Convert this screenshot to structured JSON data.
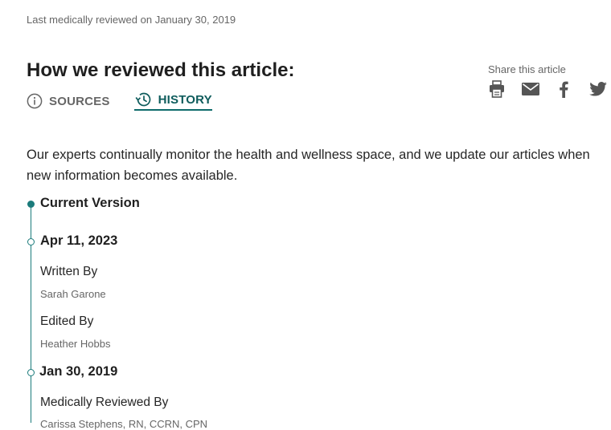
{
  "reviewed_line": "Last medically reviewed on January 30, 2019",
  "section_title": "How we reviewed this article:",
  "tabs": [
    {
      "label": "SOURCES",
      "icon": "info-icon"
    },
    {
      "label": "HISTORY",
      "icon": "history-icon",
      "active": true
    }
  ],
  "share": {
    "label": "Share this article",
    "icons": [
      "print-icon",
      "mail-icon",
      "facebook-icon",
      "twitter-icon"
    ]
  },
  "intro": "Our experts continually monitor the health and wellness space, and we update our articles when new information becomes available.",
  "timeline": {
    "current_label": "Current Version",
    "entries": [
      {
        "date": "Apr 11, 2023",
        "written_by_label": "Written By",
        "written_by": "Sarah Garone",
        "edited_by_label": "Edited By",
        "edited_by": "Heather Hobbs"
      },
      {
        "date": "Jan 30, 2019",
        "reviewed_by_label": "Medically Reviewed By",
        "reviewed_by": "Carissa Stephens, RN, CCRN, CPN"
      }
    ]
  },
  "colors": {
    "accent": "#0e6b6b",
    "muted_text": "#666666",
    "body_text": "#262626"
  }
}
